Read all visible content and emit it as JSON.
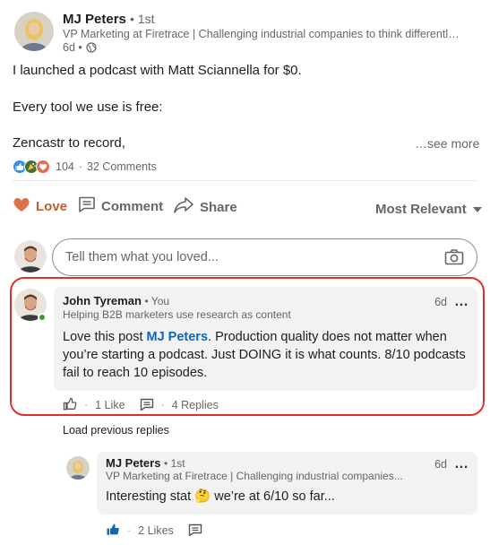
{
  "post": {
    "author": {
      "name": "MJ Peters",
      "degree": "• 1st",
      "headline": "VP Marketing at Firetrace | Challenging industrial companies to think differentl…",
      "age": "6d •"
    },
    "lines": [
      "I launched a podcast with Matt Sciannella for $0.",
      "Every tool we use is free:",
      "Zencastr to record,"
    ],
    "see_more": "…see more",
    "reaction_count": "104",
    "separator": "·",
    "comments_count": "32 Comments"
  },
  "actions": {
    "love": "Love",
    "comment": "Comment",
    "share": "Share",
    "sort": "Most Relevant"
  },
  "composer": {
    "placeholder": "Tell them what you loved..."
  },
  "comments": [
    {
      "name": "John Tyreman",
      "relation": "• You",
      "headline": "Helping B2B marketers use research as content",
      "time": "6d",
      "more": "…",
      "body_before": "Love this post ",
      "mention": "MJ Peters",
      "body_after": ". Production quality does not matter when you’re starting a podcast. Just DOING it is what counts. 8/10 podcasts fail to reach 10 episodes.",
      "likes": "1 Like",
      "replies": "4 Replies",
      "separator": "·"
    }
  ],
  "load_previous": "Load previous replies",
  "replies": [
    {
      "name": "MJ Peters",
      "relation": "• 1st",
      "headline": "VP Marketing at Firetrace | Challenging industrial companies...",
      "time": "6d",
      "more": "…",
      "body": "Interesting stat 🤔 we’re at 6/10 so far...",
      "likes": "2 Likes",
      "separator": "·"
    }
  ],
  "colors": {
    "accent": "#0a66c2",
    "love": "#c85a2a",
    "highlight": "#e0302b",
    "online": "#3a9a34"
  }
}
